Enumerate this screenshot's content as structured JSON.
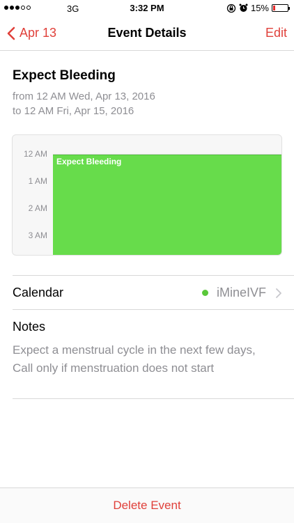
{
  "status_bar": {
    "network": "3G",
    "time": "3:32 PM",
    "battery_percent": "15%",
    "battery_level": 0.15,
    "signal_bars_filled": 3,
    "signal_bars_total": 5
  },
  "nav": {
    "back_label": "Apr 13",
    "title": "Event Details",
    "edit_label": "Edit"
  },
  "event": {
    "title": "Expect Bleeding",
    "from": "from 12 AM Wed, Apr 13, 2016",
    "to": "to 12 AM Fri, Apr 15, 2016",
    "color": "#67dc4b"
  },
  "timeline": {
    "hours": [
      "12 AM",
      "1 AM",
      "2 AM",
      "3 AM"
    ],
    "event_label": "Expect Bleeding"
  },
  "calendar": {
    "label": "Calendar",
    "value": "iMineIVF",
    "dot_color": "#5ac83a"
  },
  "notes": {
    "label": "Notes",
    "body": "Expect a menstrual cycle in the next few days, Call only if menstruation does not start"
  },
  "footer": {
    "delete_label": "Delete Event"
  },
  "colors": {
    "accent": "#e0403a",
    "secondary_text": "#8e8e93"
  }
}
